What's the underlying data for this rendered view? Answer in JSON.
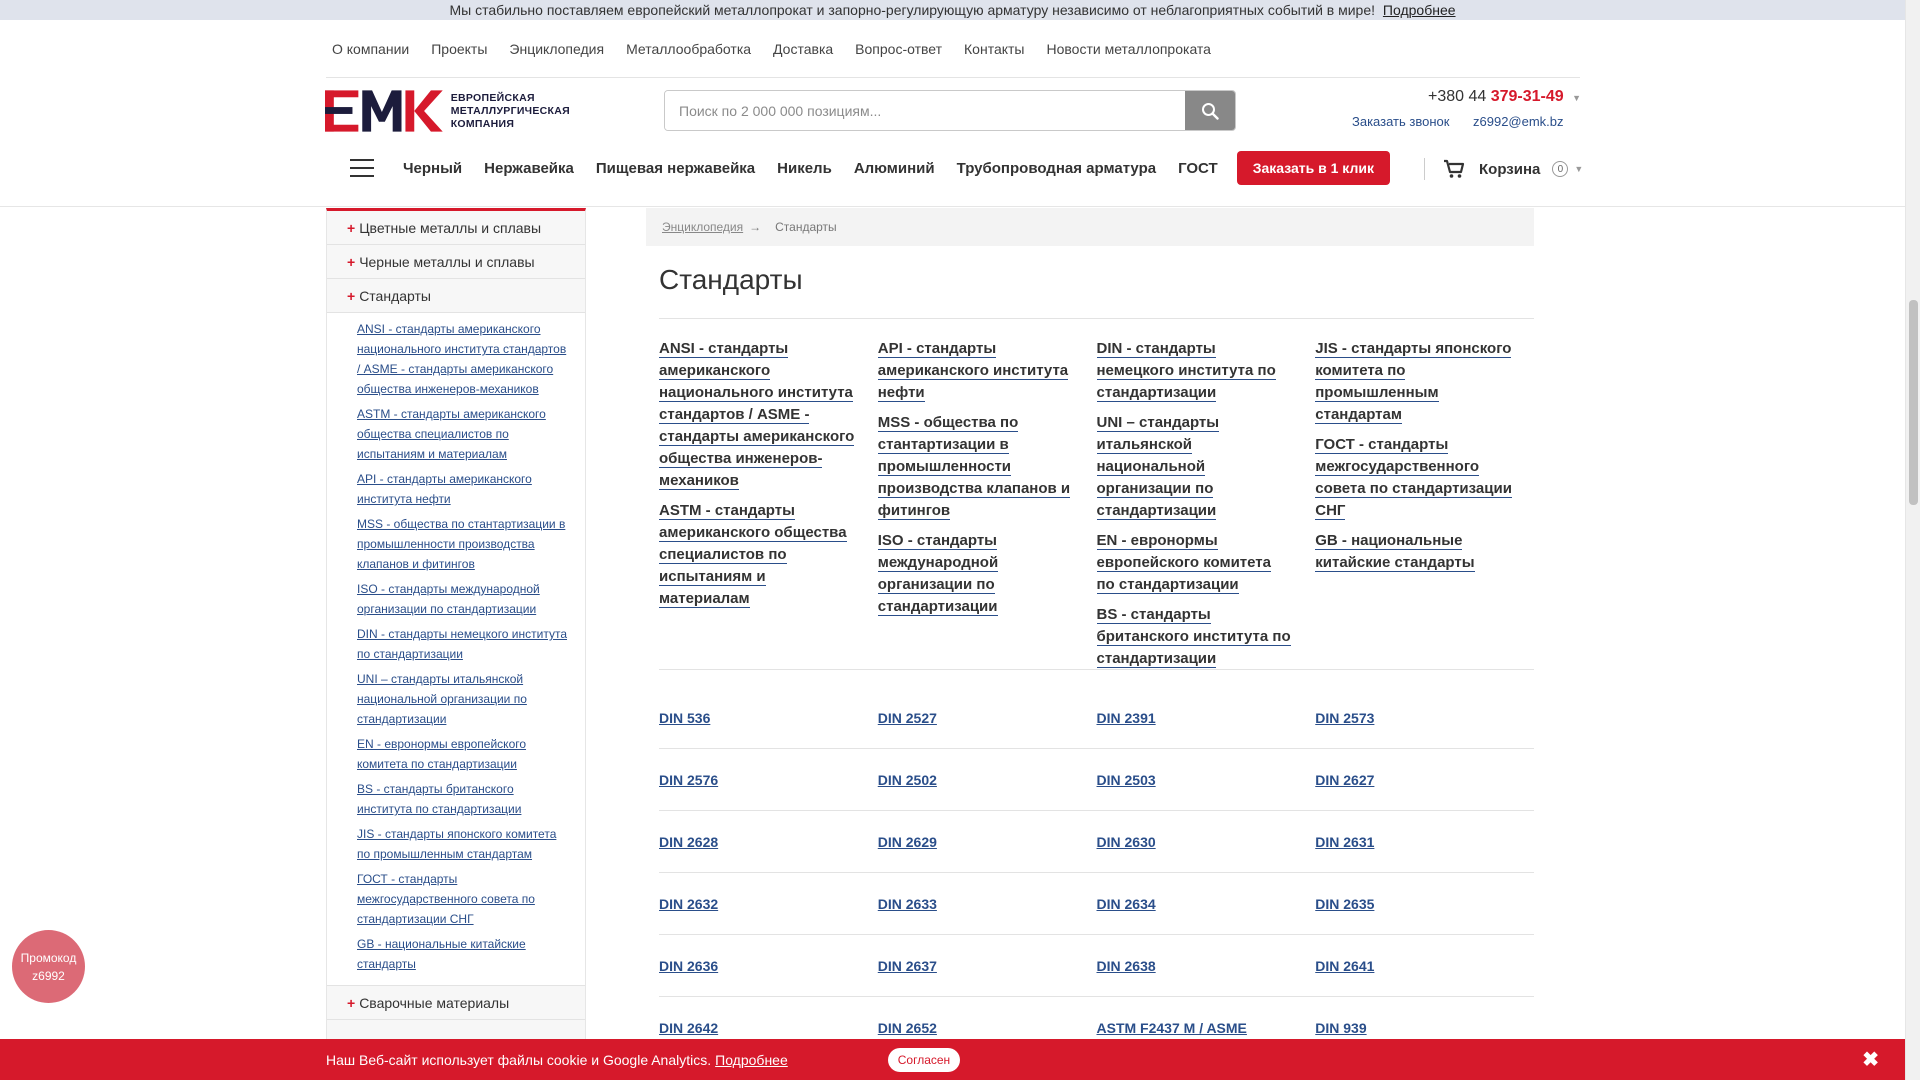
{
  "notice": {
    "text": "Мы стабильно поставляем европейский металлопрокат и запорно-регулирующую арматуру независимо от неблагоприятных событий в мире!",
    "more": "Подробнее"
  },
  "topnav": [
    "О компании",
    "Проекты",
    "Энциклопедия",
    "Металлообработка",
    "Доставка",
    "Вопрос-ответ",
    "Контакты",
    "Новости металлопроката"
  ],
  "logo": {
    "mark": "ЕМК",
    "line1": "ЕВРОПЕЙСКАЯ",
    "line2": "МЕТАЛЛУРГИЧЕСКАЯ",
    "line3": "КОМПАНИЯ"
  },
  "search": {
    "placeholder": "Поиск по 2 000 000 позициям..."
  },
  "contacts": {
    "phone_prefix": "+380 44",
    "phone_main": "379-31-49",
    "callback": "Заказать звонок",
    "email": "z6992@emk.bz"
  },
  "catbar": {
    "items": [
      "Черный",
      "Нержавейка",
      "Пищевая нержавейка",
      "Никель",
      "Алюминий",
      "Трубопроводная арматура",
      "ГОСТ"
    ],
    "cta": "Заказать в 1 клик",
    "cart": "Корзина",
    "cart_count": "0"
  },
  "sidebar": {
    "sections_top": [
      "Цветные металлы и сплавы",
      "Черные металлы и сплавы",
      "Стандарты"
    ],
    "links": [
      "ANSI - стандарты американского национального института стандартов / ASME - стандарты американского общества инженеров-механиков",
      "ASTM - стандарты американского общества специалистов по испытаниям и материалам",
      "API - стандарты американского института нефти",
      "MSS - общества по стантартизации в промышленности производства клапанов и фитингов",
      "ISO - стандарты международной организации по стандартизации",
      "DIN - стандарты немецкого института по стандартизации",
      "UNI – стандарты итальянской национальной организации по стандартизации",
      "EN - евронормы европейского комитета по стандартизации",
      "BS - стандарты британского института по стандартизации",
      "JIS - стандарты японского комитета по промышленным стандартам",
      "ГОСТ - стандарты межгосударственного совета по стандартизации СНГ",
      "GB - национальные китайские стандарты"
    ],
    "section_bottom": "Сварочные материалы"
  },
  "breadcrumb": {
    "parent": "Энциклопедия",
    "arrow": "→",
    "current": "Стандарты"
  },
  "page_title": "Стандарты",
  "standards": [
    [
      "ANSI - стандарты американского национального института стандартов / ASME - стандарты американского общества инженеров-механиков",
      "ASTM - стандарты американского общества специалистов по испытаниям и материалам"
    ],
    [
      "API - стандарты американского института нефти",
      "MSS - общества по стантартизации в промышленности производства клапанов и фитингов",
      "ISO - стандарты международной организации по стандартизации"
    ],
    [
      "DIN - стандарты немецкого института по стандартизации",
      "UNI – стандарты итальянской национальной организации по стандартизации",
      "EN - евронормы европейского комитета по стандартизации",
      "BS - стандарты британского института по стандартизации"
    ],
    [
      "JIS - стандарты японского комитета по промышленным стандартам",
      "ГОСТ - стандарты межгосударственного совета по стандартизации СНГ",
      "GB - национальные китайские стандарты"
    ]
  ],
  "din_rows": [
    [
      "DIN 536",
      "DIN 2527",
      "DIN 2391",
      "DIN 2573"
    ],
    [
      "DIN 2576",
      "DIN 2502",
      "DIN 2503",
      "DIN 2627"
    ],
    [
      "DIN 2628",
      "DIN 2629",
      "DIN 2630",
      "DIN 2631"
    ],
    [
      "DIN 2632",
      "DIN 2633",
      "DIN 2634",
      "DIN 2635"
    ],
    [
      "DIN 2636",
      "DIN 2637",
      "DIN 2638",
      "DIN 2641"
    ],
    [
      "DIN 2642",
      "DIN 2652",
      "ASTM F2437 M / ASME",
      "DIN 939"
    ]
  ],
  "promo": {
    "line1": "Промокод",
    "line2": "z6992"
  },
  "cookie": {
    "text": "Наш Веб-сайт использует файлы cookie и Google Analytics.",
    "more": "Подробнее",
    "agree": "Согласен",
    "close": "✖"
  },
  "colors": {
    "accent": "#d6192b",
    "link": "#2a4e8a"
  }
}
